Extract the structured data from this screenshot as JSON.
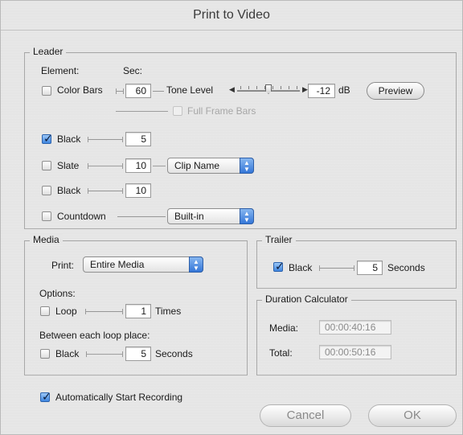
{
  "window": {
    "title": "Print to Video"
  },
  "leader": {
    "title": "Leader",
    "element_header": "Element:",
    "sec_header": "Sec:",
    "color_bars": {
      "label": "Color Bars",
      "sec": "60",
      "checked": false
    },
    "tone_level": {
      "label": "Tone Level",
      "value": "-12",
      "unit": "dB",
      "level": 0.5
    },
    "preview_label": "Preview",
    "full_frame_bars": {
      "label": "Full Frame Bars",
      "enabled": false
    },
    "black1": {
      "label": "Black",
      "sec": "5",
      "checked": true
    },
    "slate": {
      "label": "Slate",
      "sec": "10",
      "checked": false,
      "source": "Clip Name"
    },
    "black2": {
      "label": "Black",
      "sec": "10",
      "checked": false
    },
    "countdown": {
      "label": "Countdown",
      "checked": false,
      "source": "Built-in"
    }
  },
  "media": {
    "title": "Media",
    "print_label": "Print:",
    "print_value": "Entire Media",
    "options_label": "Options:",
    "loop": {
      "label": "Loop",
      "value": "1",
      "unit": "Times",
      "checked": false
    },
    "between_label": "Between each loop place:",
    "black": {
      "label": "Black",
      "value": "5",
      "unit": "Seconds",
      "checked": false
    }
  },
  "trailer": {
    "title": "Trailer",
    "black": {
      "label": "Black",
      "value": "5",
      "unit": "Seconds",
      "checked": true
    }
  },
  "duration": {
    "title": "Duration Calculator",
    "media_label": "Media:",
    "media_value": "00:00:40:16",
    "total_label": "Total:",
    "total_value": "00:00:50:16"
  },
  "auto_start": {
    "label": "Automatically Start Recording",
    "checked": true
  },
  "buttons": {
    "cancel": "Cancel",
    "ok": "OK"
  },
  "colors": {
    "accent": "#3f86e0",
    "window_bg": "#e6e6e6"
  }
}
